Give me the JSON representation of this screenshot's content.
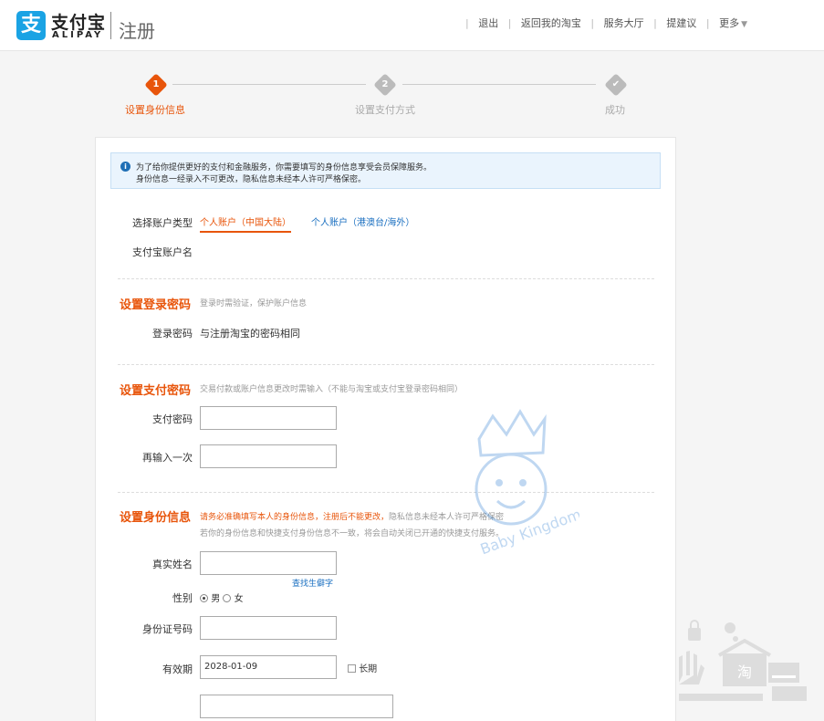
{
  "header": {
    "logo_cn": "支付宝",
    "logo_en": "ALIPAY",
    "page_title": "注册",
    "nav": [
      "退出",
      "返回我的淘宝",
      "服务大厅",
      "提建议",
      "更多"
    ]
  },
  "steps": [
    {
      "num": "1",
      "label": "设置身份信息",
      "state": "active"
    },
    {
      "num": "2",
      "label": "设置支付方式",
      "state": "pending"
    },
    {
      "num": "✔",
      "label": "成功",
      "state": "pending"
    }
  ],
  "notice": {
    "line1": "为了给你提供更好的支付和金融服务，你需要填写的身份信息享受会员保障服务。",
    "line2": "身份信息一经录入不可更改，隐私信息未经本人许可严格保密。"
  },
  "account": {
    "type_label": "选择账户类型",
    "tabs": [
      "个人账户（中国大陆）",
      "个人账户（港澳台/海外）"
    ],
    "name_label": "支付宝账户名"
  },
  "login_pwd": {
    "title": "设置登录密码",
    "hint": "登录时需验证，保护账户信息",
    "label": "登录密码",
    "value": "与注册淘宝的密码相同"
  },
  "pay_pwd": {
    "title": "设置支付密码",
    "hint": "交易付款或账户信息更改时需输入（不能与淘宝或支付宝登录密码相同）",
    "label": "支付密码",
    "confirm_label": "再输入一次"
  },
  "identity": {
    "title": "设置身份信息",
    "warn": "请务必准确填写本人的身份信息，注册后不能更改，",
    "hint1": "隐私信息未经本人许可严格保密",
    "hint2": "若你的身份信息和快捷支付身份信息不一致，将会自动关闭已开通的快捷支付服务。",
    "name_label": "真实姓名",
    "rare_char_link": "查找生僻字",
    "gender_label": "性别",
    "gender_male": "男",
    "gender_female": "女",
    "id_label": "身份证号码",
    "expiry_label": "有效期",
    "expiry_value": "2028-01-09",
    "long_term_label": "长期"
  },
  "watermark_text": "Baby Kingdom",
  "corner_widget_text": "淘",
  "colors": {
    "accent": "#e8550b",
    "link": "#1a6fc0",
    "brand": "#1aa3e4"
  }
}
